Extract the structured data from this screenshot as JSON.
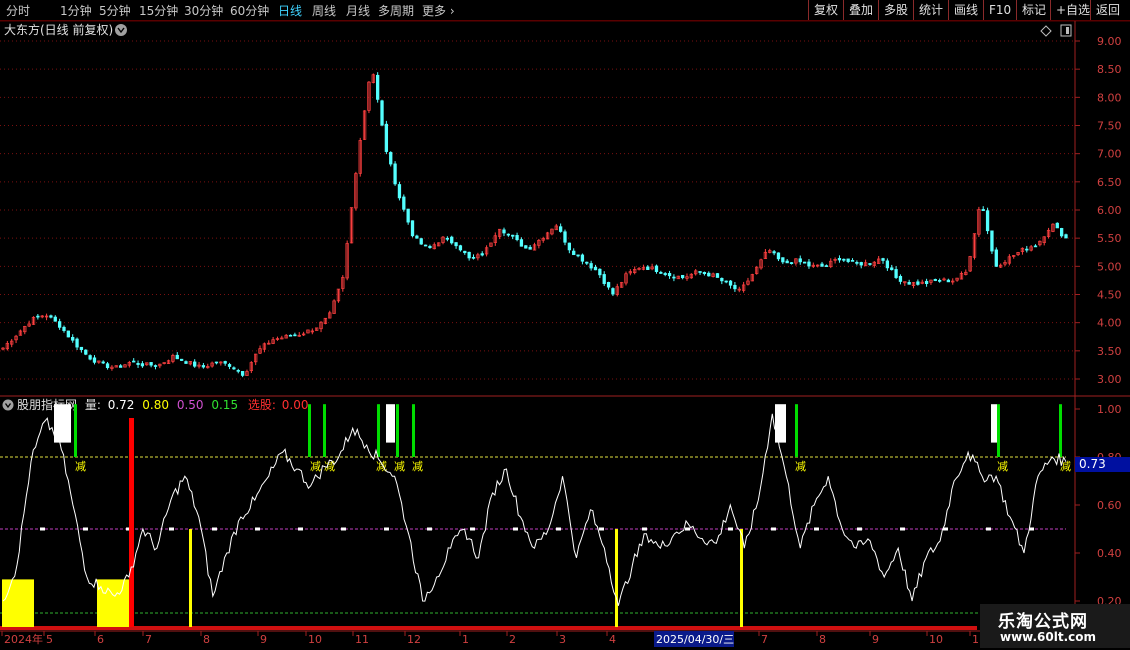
{
  "toolbar": {
    "periods": [
      "分时",
      "1分钟",
      "5分钟",
      "15分钟",
      "30分钟",
      "60分钟",
      "日线",
      "周线",
      "月线",
      "多周期",
      "更多"
    ],
    "active_period": "日线",
    "right_buttons": [
      "复权",
      "叠加",
      "多股",
      "统计",
      "画线",
      "F10",
      "标记",
      "+自选",
      "返回"
    ]
  },
  "price_panel": {
    "title": "大东方(日线 前复权)",
    "y_ticks": [
      "9.00",
      "8.50",
      "8.00",
      "7.50",
      "7.00",
      "6.50",
      "6.00",
      "5.50",
      "5.00",
      "4.50",
      "4.00",
      "3.50",
      "3.00"
    ]
  },
  "indicator_panel": {
    "name": "股朋指标网",
    "legend_label": "量:",
    "legend_values": [
      "0.72",
      "0.80",
      "0.50",
      "0.15"
    ],
    "select_label": "选股:",
    "select_value": "0.00",
    "y_ticks": [
      "1.00",
      "0.80",
      "0.60",
      "0.40",
      "0.20"
    ],
    "current_value": "0.73",
    "reduce_label": "减"
  },
  "x_axis": {
    "labels": [
      "2024年",
      "5",
      "6",
      "7",
      "8",
      "9",
      "10",
      "11",
      "12",
      "1",
      "2",
      "3",
      "4",
      "7",
      "8",
      "9",
      "10",
      "1"
    ],
    "cursor_date": "2025/04/30/三"
  },
  "colors": {
    "up": "#ff4040",
    "down": "#54ffff",
    "yellow": "#ffff00",
    "green": "#00dd00",
    "red_line": "#ff0000",
    "magenta": "#c040c0",
    "cyan_active": "#3fd3ff"
  },
  "chart_data": {
    "type": "line",
    "title": "",
    "price_ylim": [
      2.9,
      9.1
    ],
    "indicator_ylim": [
      0.1,
      1.05
    ],
    "reference_lines": [
      0.8,
      0.5,
      0.15
    ],
    "price_series_close": [
      3.55,
      3.8,
      4.05,
      4.15,
      3.95,
      3.65,
      3.4,
      3.25,
      3.2,
      3.3,
      3.25,
      3.25,
      3.4,
      3.3,
      3.2,
      3.3,
      3.25,
      3.08,
      3.5,
      3.7,
      3.75,
      3.8,
      3.9,
      4.1,
      4.8,
      6.9,
      8.6,
      7.1,
      6.2,
      5.5,
      5.3,
      5.5,
      5.4,
      5.1,
      5.25,
      5.7,
      5.5,
      5.3,
      5.5,
      5.75,
      5.3,
      5.1,
      4.9,
      4.5,
      4.85,
      5.0,
      4.95,
      4.85,
      4.8,
      4.9,
      4.85,
      4.7,
      4.55,
      4.9,
      5.3,
      5.05,
      5.1,
      5.0,
      5.0,
      5.15,
      5.05,
      5.05,
      5.15,
      4.8,
      4.7,
      4.7,
      4.75,
      4.75,
      4.9,
      6.2,
      5.0,
      5.15,
      5.3,
      5.4,
      5.75,
      5.5
    ],
    "indicator_series": [
      0.2,
      0.35,
      0.78,
      0.95,
      0.88,
      0.6,
      0.3,
      0.26,
      0.22,
      0.3,
      0.5,
      0.42,
      0.62,
      0.72,
      0.55,
      0.22,
      0.4,
      0.55,
      0.62,
      0.72,
      0.82,
      0.75,
      0.68,
      0.76,
      0.8,
      0.92,
      0.85,
      0.78,
      0.72,
      0.48,
      0.2,
      0.3,
      0.42,
      0.5,
      0.38,
      0.65,
      0.75,
      0.55,
      0.42,
      0.5,
      0.72,
      0.38,
      0.58,
      0.42,
      0.18,
      0.35,
      0.48,
      0.42,
      0.48,
      0.52,
      0.46,
      0.44,
      0.6,
      0.42,
      0.62,
      0.98,
      0.72,
      0.42,
      0.6,
      0.72,
      0.5,
      0.42,
      0.45,
      0.3,
      0.42,
      0.2,
      0.38,
      0.45,
      0.7,
      0.82,
      0.72,
      0.72,
      0.55,
      0.4,
      0.72,
      0.8,
      0.78
    ]
  }
}
